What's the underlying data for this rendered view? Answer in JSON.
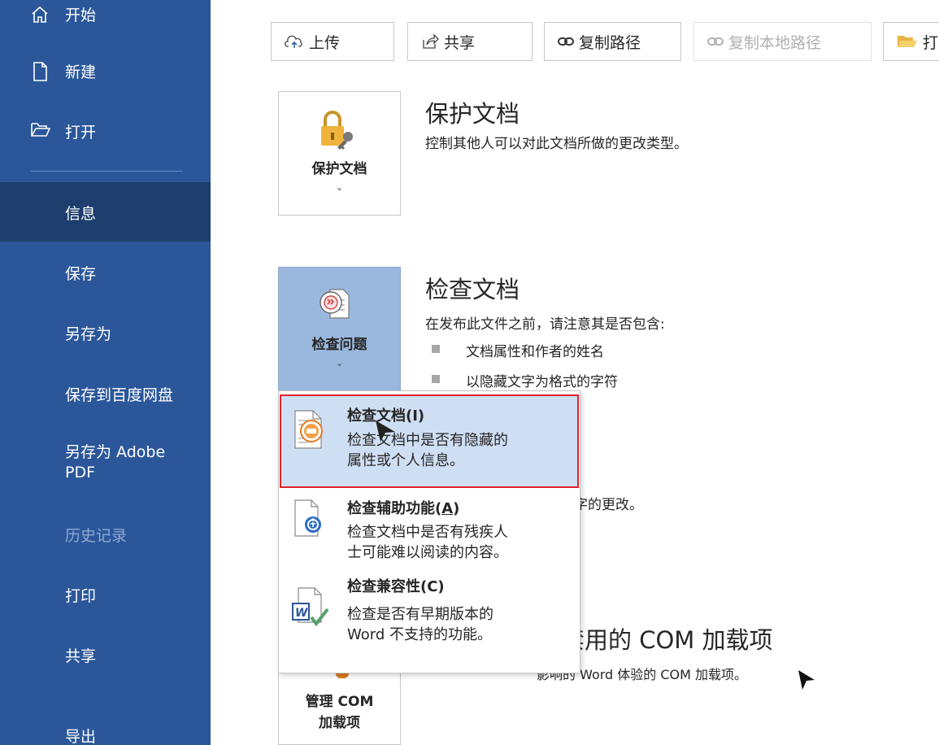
{
  "sidebar": {
    "items": [
      {
        "label": "开始"
      },
      {
        "label": "新建"
      },
      {
        "label": "打开"
      },
      {
        "label": "信息"
      },
      {
        "label": "保存"
      },
      {
        "label": "另存为"
      },
      {
        "label": "保存到百度网盘"
      },
      {
        "label": "另存为 Adobe PDF"
      },
      {
        "label": "历史记录"
      },
      {
        "label": "打印"
      },
      {
        "label": "共享"
      },
      {
        "label": "导出"
      }
    ],
    "active": "信息",
    "colors": {
      "background": "#2b579a",
      "active": "#1e3e6e"
    }
  },
  "toolbar": {
    "upload": "上传",
    "share": "共享",
    "copy_path": "复制路径",
    "copy_local_path": "复制本地路径",
    "open_location": "打"
  },
  "protect": {
    "button_label": "保护文档",
    "title": "保护文档",
    "description": "控制其他人可以对此文档所做的更改类型。"
  },
  "inspect": {
    "button_label": "检查问题",
    "title": "检查文档",
    "description": "在发布此文件之前，请注意其是否包含:",
    "bullets": [
      "文档属性和作者的姓名",
      "以隐藏文字为格式的字符"
    ],
    "partial_text": "字的更改。"
  },
  "com": {
    "button_label_line1": "管理 COM",
    "button_label_line2": "加载项",
    "title_partial": "禁用的 COM 加载项",
    "description_partial": "影响的 Word 体验的 COM 加载项。"
  },
  "dropdown": {
    "items": [
      {
        "title": "检查文档(I)",
        "desc_line1": "检查文档中是否有隐藏的",
        "desc_line2": "属性或个人信息。",
        "icon": "inspect-document-icon",
        "highlighted": true
      },
      {
        "title_pre": "检查辅助功能(",
        "title_key": "A",
        "title_post": ")",
        "desc_line1": "检查文档中是否有残疾人",
        "desc_line2": "士可能难以阅读的内容。",
        "icon": "accessibility-check-icon"
      },
      {
        "title": "检查兼容性(C)",
        "desc_line1": "检查是否有早期版本的",
        "desc_line2": "Word 不支持的功能。",
        "icon": "compatibility-check-icon"
      }
    ],
    "highlight_color": "#e0222c"
  }
}
